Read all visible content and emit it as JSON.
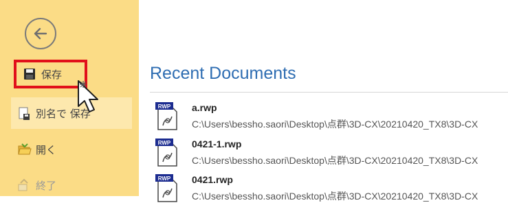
{
  "sidebar": {
    "menu": {
      "save": "保存",
      "save_as": "別名で 保存",
      "open": "開く",
      "close": "終了"
    }
  },
  "main": {
    "section_title": "Recent Documents",
    "documents": [
      {
        "name": "a.rwp",
        "path": "C:\\Users\\bessho.saori\\Desktop\\点群\\3D-CX\\20210420_TX8\\3D-CX",
        "icon": "rwp-file-icon"
      },
      {
        "name": "0421-1.rwp",
        "path": "C:\\Users\\bessho.saori\\Desktop\\点群\\3D-CX\\20210420_TX8\\3D-CX",
        "icon": "rwp-file-icon"
      },
      {
        "name": "0421.rwp",
        "path": "C:\\Users\\bessho.saori\\Desktop\\点群\\3D-CX\\20210420_TX8\\3D-CX",
        "icon": "rwp-file-icon"
      }
    ],
    "icon_label": "RWP"
  },
  "colors": {
    "sidebar_bg": "#fbdc86",
    "highlight_bg": "#fde8ad",
    "accent": "#2e6db2",
    "save_outline": "#e1101a"
  }
}
